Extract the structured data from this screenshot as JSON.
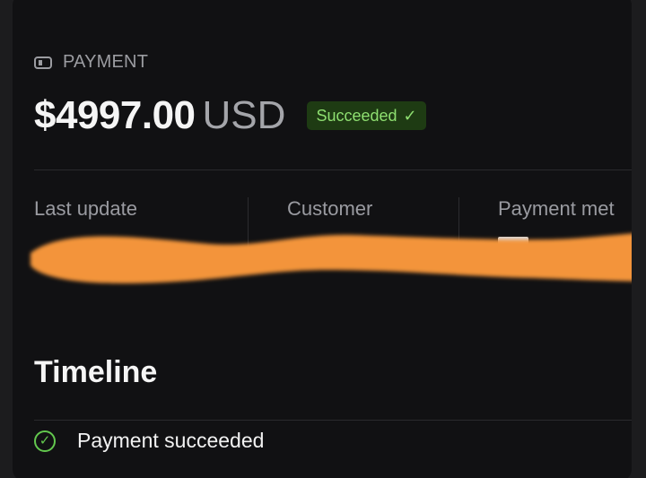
{
  "payment": {
    "kicker_label": "PAYMENT",
    "amount": "$4997.00",
    "currency": "USD",
    "status_label": "Succeeded",
    "status_icon": "check-icon"
  },
  "details": {
    "last_update_label": "Last update",
    "customer_label": "Customer",
    "payment_method_label": "Payment met"
  },
  "timeline": {
    "title": "Timeline",
    "items": [
      {
        "label": "Payment succeeded",
        "icon": "check-circle-icon"
      }
    ]
  },
  "redaction": {
    "color": "#f3943b"
  },
  "colors": {
    "success": "#8edf70",
    "success_bg": "#1e3b13",
    "background": "#111113"
  }
}
